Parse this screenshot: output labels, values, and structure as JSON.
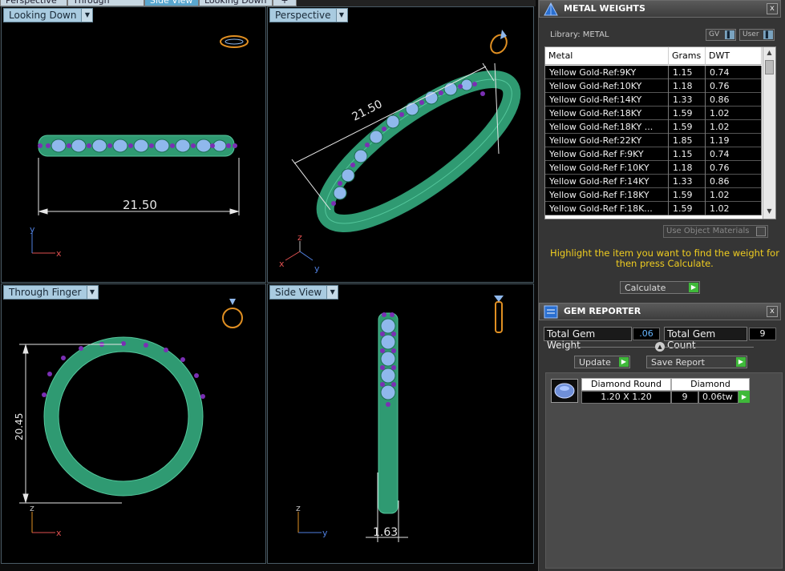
{
  "tabs": [
    "Perspective",
    "Through Finger",
    "Side View",
    "Looking Down"
  ],
  "tab_add": "+",
  "viewports": {
    "top_left": {
      "label": "Looking Down",
      "dimension": "21.50",
      "axis_h": "x",
      "axis_v": "y"
    },
    "top_right": {
      "label": "Perspective",
      "dimension": "21.50",
      "axis_x": "x",
      "axis_y": "y",
      "axis_z": "z"
    },
    "bottom_left": {
      "label": "Through Finger",
      "dimension": "20.45",
      "axis_h": "x",
      "axis_v": "z"
    },
    "bottom_right": {
      "label": "Side View",
      "dimension": "1.63",
      "axis_h": "y",
      "axis_v": "z"
    }
  },
  "dropdown_glyph": "▼",
  "metal_weights": {
    "title": "METAL WEIGHTS",
    "close": "x",
    "library_label": "Library: METAL",
    "gv_label": "GV",
    "user_label": "User",
    "toggle_glyph": "▌",
    "columns": [
      "Metal",
      "Grams",
      "DWT"
    ],
    "rows": [
      [
        "Yellow Gold-Ref:9KY",
        "1.15",
        "0.74"
      ],
      [
        "Yellow Gold-Ref:10KY",
        "1.18",
        "0.76"
      ],
      [
        "Yellow Gold-Ref:14KY",
        "1.33",
        "0.86"
      ],
      [
        "Yellow Gold-Ref:18KY",
        "1.59",
        "1.02"
      ],
      [
        "Yellow Gold-Ref:18KY ...",
        "1.59",
        "1.02"
      ],
      [
        "Yellow Gold-Ref:22KY",
        "1.85",
        "1.19"
      ],
      [
        "Yellow Gold-Ref F:9KY",
        "1.15",
        "0.74"
      ],
      [
        "Yellow Gold-Ref F:10KY",
        "1.18",
        "0.76"
      ],
      [
        "Yellow Gold-Ref F:14KY",
        "1.33",
        "0.86"
      ],
      [
        "Yellow Gold-Ref F:18KY",
        "1.59",
        "1.02"
      ],
      [
        "Yellow Gold-Ref F:18K...",
        "1.59",
        "1.02"
      ]
    ],
    "use_object_materials": "Use Object Materials",
    "hint": "Highlight the item you want to find the weight for then press Calculate.",
    "calculate_label": "Calculate",
    "go_glyph": "▶",
    "scroll_up": "▲",
    "scroll_down": "▼"
  },
  "gem_reporter": {
    "title": "GEM REPORTER",
    "close": "x",
    "total_weight_label": "Total Gem Weight",
    "total_weight_value": ".06",
    "total_count_label": "Total Gem Count",
    "total_count_value": "9",
    "update_label": "Update",
    "save_report_label": "Save Report",
    "collapse_glyph": "▲",
    "gems": [
      {
        "shape": "Diamond Round",
        "size": "1.20 X 1.20",
        "material": "Diamond",
        "count": "9",
        "weight": "0.06tw"
      }
    ]
  },
  "colors": {
    "ring": "#2f9a72",
    "ring_light": "#54c79c",
    "gem": "#8fb8ec",
    "prong": "#7a2fb4",
    "dim": "#e6e6e6",
    "gold": "#e08f22",
    "hint": "#f0cd20",
    "go": "#3fb93a"
  }
}
